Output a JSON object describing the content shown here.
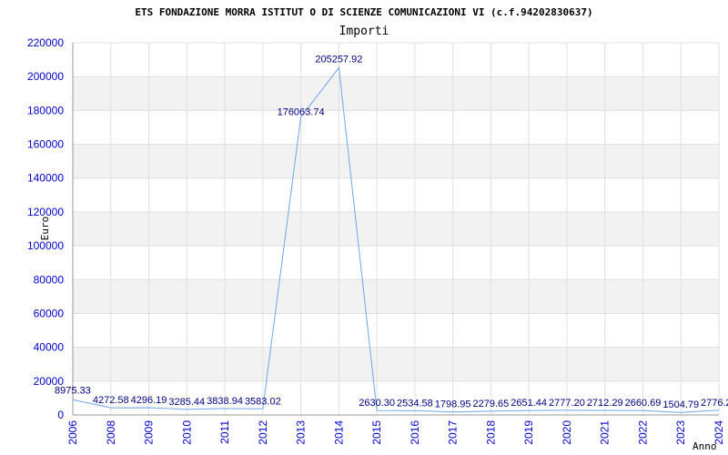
{
  "chart_data": {
    "type": "line",
    "title": "ETS FONDAZIONE MORRA ISTITUT O DI SCIENZE COMUNICAZIONI VI (c.f.94202830637)",
    "subtitle": "Importi",
    "xlabel": "Anno",
    "ylabel": "Euro",
    "ylim": [
      0,
      220000
    ],
    "yticks": [
      "0",
      "20000",
      "40000",
      "60000",
      "80000",
      "100000",
      "120000",
      "140000",
      "160000",
      "180000",
      "200000",
      "220000"
    ],
    "x": [
      "2006",
      "2008",
      "2009",
      "2010",
      "2011",
      "2012",
      "2013",
      "2014",
      "2015",
      "2016",
      "2017",
      "2018",
      "2019",
      "2020",
      "2021",
      "2022",
      "2023",
      "2024"
    ],
    "series": [
      {
        "values": [
          8975.33,
          4272.58,
          4296.19,
          3285.44,
          3838.94,
          3583.02,
          176063.74,
          205257.92,
          2630.3,
          2534.58,
          1798.95,
          2279.65,
          2651.44,
          2777.2,
          2712.29,
          2660.69,
          1504.79,
          2776.2
        ],
        "labels": [
          "8975.33",
          "4272.58",
          "4296.19",
          "3285.44",
          "3838.94",
          "3583.02",
          "176063.74",
          "205257.92",
          "2630.30",
          "2534.58",
          "1798.95",
          "2279.65",
          "2651.44",
          "2777.20",
          "2712.29",
          "2660.69",
          "1504.79",
          "2776.2"
        ]
      }
    ],
    "grid": true,
    "colors": {
      "line": "#6ea6e8",
      "tick_text": "#0000cc",
      "data_label": "#000080",
      "band": "#f2f2f2",
      "grid": "#e0e0e0"
    }
  }
}
